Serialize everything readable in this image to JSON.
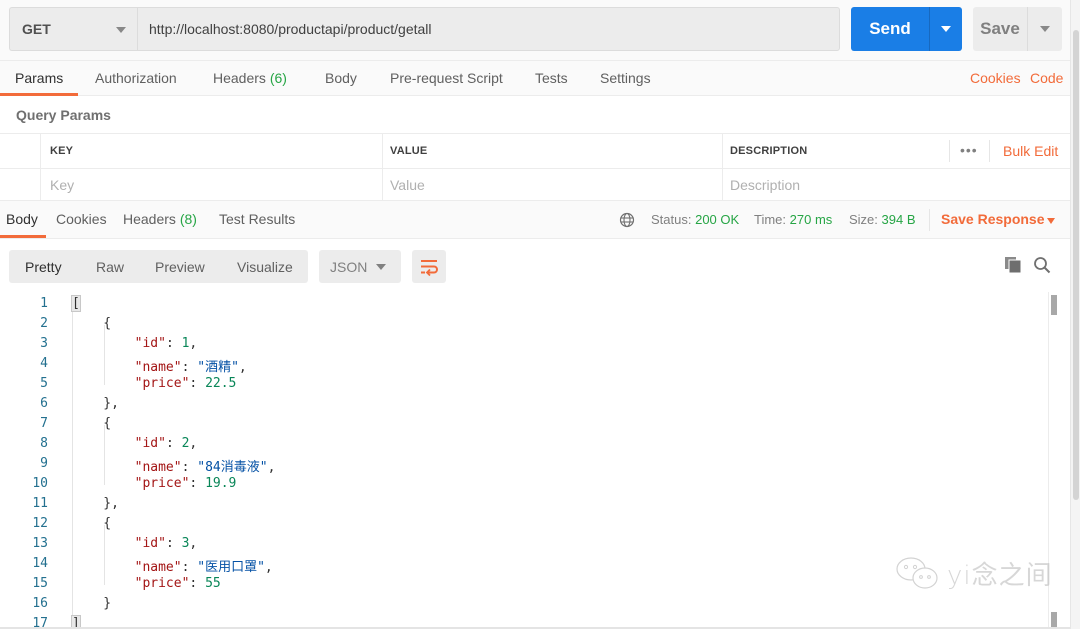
{
  "request": {
    "method": "GET",
    "url": "http://localhost:8080/productapi/product/getall",
    "send_label": "Send",
    "save_label": "Save"
  },
  "request_tabs": {
    "items": [
      {
        "label": "Params",
        "count": null,
        "active": true
      },
      {
        "label": "Authorization",
        "count": null
      },
      {
        "label": "Headers",
        "count": "(6)"
      },
      {
        "label": "Body",
        "count": null
      },
      {
        "label": "Pre-request Script",
        "count": null
      },
      {
        "label": "Tests",
        "count": null
      },
      {
        "label": "Settings",
        "count": null
      }
    ],
    "cookies_link": "Cookies",
    "code_link": "Code"
  },
  "query_params": {
    "title": "Query Params",
    "columns": [
      "KEY",
      "VALUE",
      "DESCRIPTION"
    ],
    "placeholders": {
      "key": "Key",
      "value": "Value",
      "description": "Description"
    },
    "more_label": "•••",
    "bulk_edit_label": "Bulk Edit"
  },
  "response_tabs": {
    "items": [
      {
        "label": "Body",
        "active": true
      },
      {
        "label": "Cookies"
      },
      {
        "label": "Headers",
        "count": "(8)"
      },
      {
        "label": "Test Results"
      }
    ]
  },
  "response_status": {
    "status_label": "Status:",
    "status_value": "200 OK",
    "time_label": "Time:",
    "time_value": "270 ms",
    "size_label": "Size:",
    "size_value": "394 B",
    "save_response_label": "Save Response"
  },
  "format_toolbar": {
    "views": [
      "Pretty",
      "Raw",
      "Preview",
      "Visualize"
    ],
    "active_view": "Pretty",
    "language": "JSON"
  },
  "response_body": {
    "line_numbers": [
      "1",
      "2",
      "3",
      "4",
      "5",
      "6",
      "7",
      "8",
      "9",
      "10",
      "11",
      "12",
      "13",
      "14",
      "15",
      "16",
      "17"
    ],
    "items": [
      {
        "id": "1",
        "name": "\"酒精\"",
        "price": "22.5"
      },
      {
        "id": "2",
        "name": "\"84消毒液\"",
        "price": "19.9"
      },
      {
        "id": "3",
        "name": "\"医用口罩\"",
        "price": "55"
      }
    ],
    "keys": {
      "id": "\"id\"",
      "name": "\"name\"",
      "price": "\"price\""
    }
  },
  "watermark": {
    "text": "yi念之间"
  },
  "colors": {
    "accent_orange": "#f26b3a",
    "send_blue": "#1a7ee6",
    "success_green": "#26a545",
    "json_key": "#a31515",
    "json_string": "#0451a5",
    "json_number": "#098658"
  }
}
